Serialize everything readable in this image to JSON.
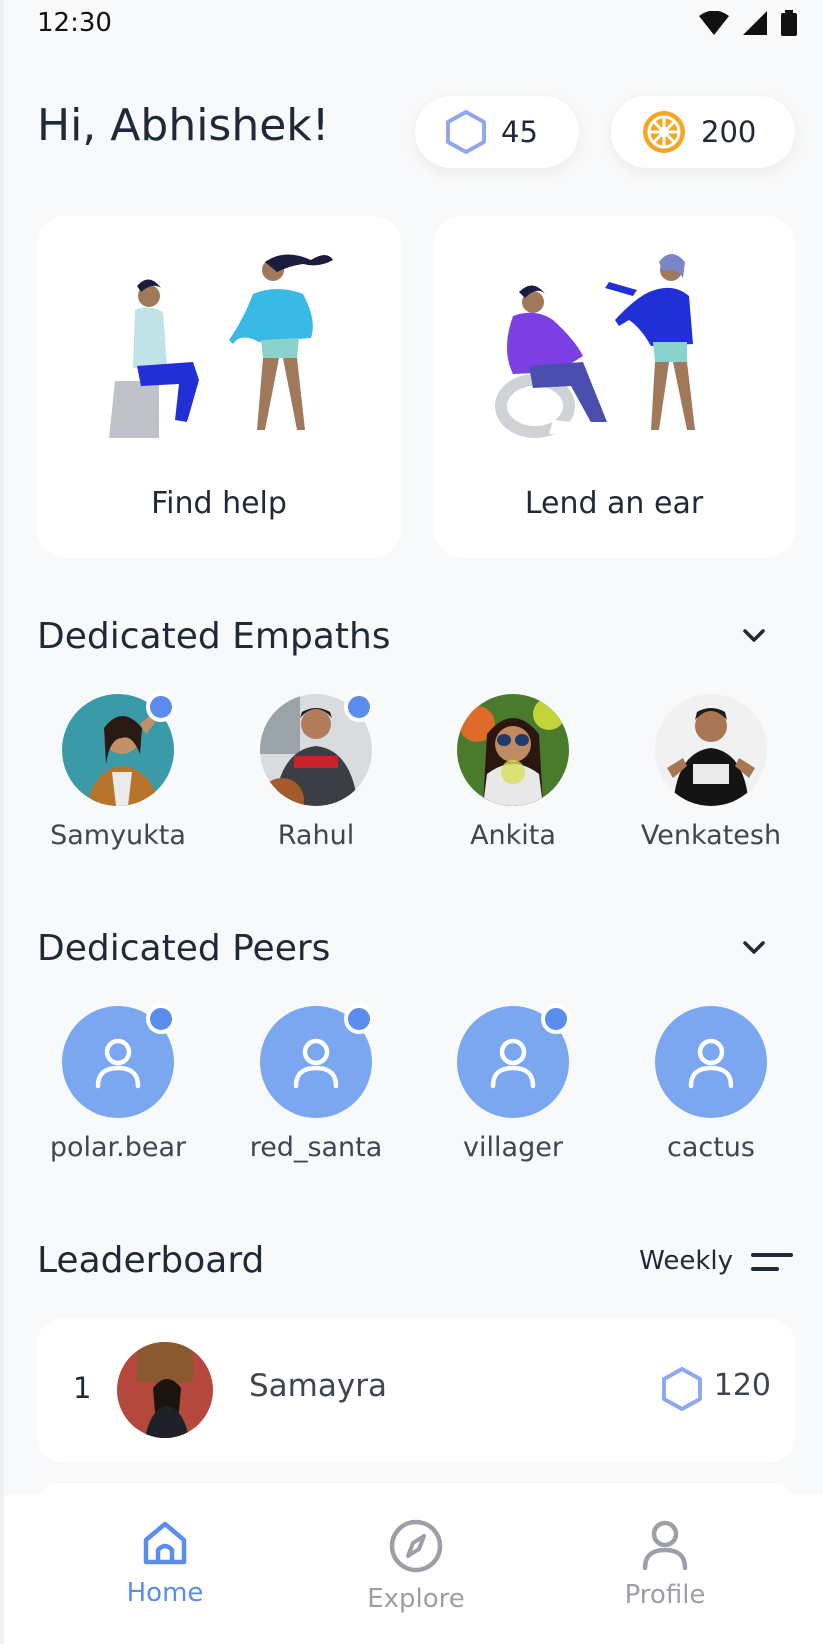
{
  "status_bar": {
    "time": "12:30"
  },
  "header": {
    "greeting": "Hi, Abhishek!",
    "tokens": "45",
    "coins": "200"
  },
  "cards": {
    "find_help": "Find help",
    "lend_ear": "Lend an ear"
  },
  "empaths": {
    "title": "Dedicated Empaths",
    "items": [
      {
        "name": "Samyukta",
        "online": true
      },
      {
        "name": "Rahul",
        "online": true
      },
      {
        "name": "Ankita",
        "online": false
      },
      {
        "name": "Venkatesh",
        "online": false
      }
    ]
  },
  "peers": {
    "title": "Dedicated Peers",
    "items": [
      {
        "name": "polar.bear",
        "online": true
      },
      {
        "name": "red_santa",
        "online": true
      },
      {
        "name": "villager",
        "online": true
      },
      {
        "name": "cactus",
        "online": false
      }
    ]
  },
  "leaderboard": {
    "title": "Leaderboard",
    "period": "Weekly",
    "entries": [
      {
        "rank": "1",
        "name": "Samayra",
        "score": "120"
      }
    ]
  },
  "nav": {
    "home": "Home",
    "explore": "Explore",
    "profile": "Profile"
  },
  "colors": {
    "accent": "#5b8def",
    "peer_avatar": "#7aa7ef",
    "coin": "#f5a623"
  }
}
